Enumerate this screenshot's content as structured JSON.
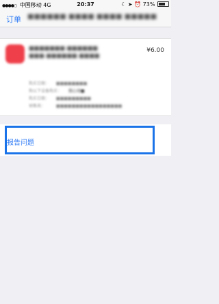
{
  "status_bar": {
    "carrier": "中国移动",
    "network": "4G",
    "time": "20:37",
    "battery": "73%",
    "battery_level": 0.73
  },
  "nav": {
    "back_label": "订单",
    "title": "■■■■■■ ■■■■ ■■■■ ■■■■■"
  },
  "order": {
    "app_name": "■■■■■■■ ■■■■■■ ■■■ ■■■■■■ ■■■■",
    "price": "¥6.00",
    "details": [
      {
        "label": "购买日期：",
        "value": "■■■■■■■■"
      },
      {
        "label": "购以下设备购买：",
        "value": "我心动■"
      },
      {
        "label": "购买日期：",
        "value": "■■■■■■■■■"
      },
      {
        "label": "销售商：",
        "value": "■■■■■■■■■■■■■■■■■"
      }
    ]
  },
  "report": {
    "label": "报告问题"
  },
  "colors": {
    "accent": "#2f7bf5",
    "highlight": "#1a73e8",
    "background": "#efeff4"
  }
}
